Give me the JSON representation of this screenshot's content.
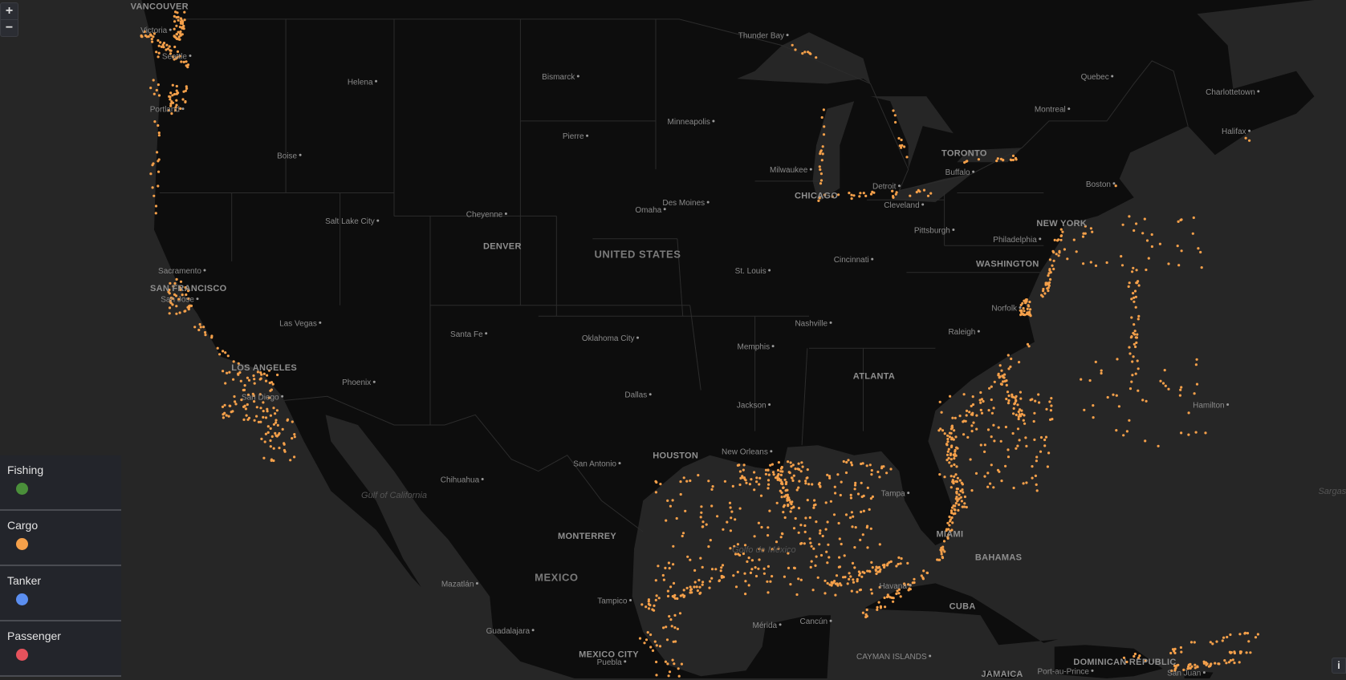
{
  "map": {
    "colors": {
      "water": "#262626",
      "land": "#0d0d0d",
      "border": "#2c2c2c",
      "vessel": "#f5a04a"
    },
    "labels": [
      {
        "name": "VANCOUVER",
        "lat": 49.5,
        "lon": -124.0,
        "cls": "major"
      },
      {
        "name": "Victoria",
        "lat": 48.6,
        "lon": -123.4,
        "cls": "city"
      },
      {
        "name": "Seattle",
        "lat": 47.6,
        "lon": -122.3,
        "cls": "city"
      },
      {
        "name": "Portland",
        "lat": 45.5,
        "lon": -122.7,
        "cls": "city"
      },
      {
        "name": "Helena",
        "lat": 46.6,
        "lon": -112.0,
        "cls": "city"
      },
      {
        "name": "Boise",
        "lat": 43.6,
        "lon": -116.2,
        "cls": "city"
      },
      {
        "name": "Salt Lake City",
        "lat": 40.8,
        "lon": -111.9,
        "cls": "city"
      },
      {
        "name": "Sacramento",
        "lat": 38.6,
        "lon": -121.5,
        "cls": "city"
      },
      {
        "name": "SAN FRANCISCO",
        "lat": 37.8,
        "lon": -122.4,
        "cls": "major"
      },
      {
        "name": "San Jose",
        "lat": 37.3,
        "lon": -121.9,
        "cls": "city"
      },
      {
        "name": "Las Vegas",
        "lat": 36.2,
        "lon": -115.1,
        "cls": "city"
      },
      {
        "name": "LOS ANGELES",
        "lat": 34.1,
        "lon": -118.2,
        "cls": "major"
      },
      {
        "name": "San Diego",
        "lat": 32.7,
        "lon": -117.2,
        "cls": "city"
      },
      {
        "name": "Phoenix",
        "lat": 33.4,
        "lon": -112.1,
        "cls": "city"
      },
      {
        "name": "Cheyenne",
        "lat": 41.1,
        "lon": -104.8,
        "cls": "city"
      },
      {
        "name": "DENVER",
        "lat": 39.7,
        "lon": -105.0,
        "cls": "major"
      },
      {
        "name": "Santa Fe",
        "lat": 35.7,
        "lon": -105.9,
        "cls": "city"
      },
      {
        "name": "UNITED STATES",
        "lat": 39.3,
        "lon": -97.5,
        "cls": "country"
      },
      {
        "name": "Bismarck",
        "lat": 46.8,
        "lon": -100.8,
        "cls": "city"
      },
      {
        "name": "Pierre",
        "lat": 44.4,
        "lon": -100.3,
        "cls": "city"
      },
      {
        "name": "Omaha",
        "lat": 41.3,
        "lon": -96.0,
        "cls": "city"
      },
      {
        "name": "Oklahoma City",
        "lat": 35.5,
        "lon": -97.5,
        "cls": "city"
      },
      {
        "name": "Dallas",
        "lat": 32.8,
        "lon": -96.8,
        "cls": "city"
      },
      {
        "name": "San Antonio",
        "lat": 29.4,
        "lon": -98.5,
        "cls": "city"
      },
      {
        "name": "HOUSTON",
        "lat": 29.8,
        "lon": -95.4,
        "cls": "major"
      },
      {
        "name": "Chihuahua",
        "lat": 28.6,
        "lon": -106.1,
        "cls": "city"
      },
      {
        "name": "Gulf of California",
        "lat": 27.8,
        "lon": -111.0,
        "cls": "water"
      },
      {
        "name": "MONTERREY",
        "lat": 25.7,
        "lon": -100.3,
        "cls": "major"
      },
      {
        "name": "MEXICO",
        "lat": 23.5,
        "lon": -102.0,
        "cls": "country"
      },
      {
        "name": "Mazatlán",
        "lat": 23.2,
        "lon": -106.4,
        "cls": "city"
      },
      {
        "name": "Tampico",
        "lat": 22.3,
        "lon": -97.9,
        "cls": "city"
      },
      {
        "name": "Guadalajara",
        "lat": 20.7,
        "lon": -103.3,
        "cls": "city"
      },
      {
        "name": "MEXICO CITY",
        "lat": 19.4,
        "lon": -99.1,
        "cls": "major"
      },
      {
        "name": "Puebla",
        "lat": 19.0,
        "lon": -98.2,
        "cls": "city"
      },
      {
        "name": "Minneapolis",
        "lat": 45.0,
        "lon": -93.3,
        "cls": "city"
      },
      {
        "name": "Des Moines",
        "lat": 41.6,
        "lon": -93.6,
        "cls": "city"
      },
      {
        "name": "St. Louis",
        "lat": 38.6,
        "lon": -90.2,
        "cls": "city"
      },
      {
        "name": "Memphis",
        "lat": 35.1,
        "lon": -90.0,
        "cls": "city"
      },
      {
        "name": "Jackson",
        "lat": 32.3,
        "lon": -90.2,
        "cls": "city"
      },
      {
        "name": "New Orleans",
        "lat": 30.0,
        "lon": -90.1,
        "cls": "city"
      },
      {
        "name": "Golfo de México",
        "lat": 25.0,
        "lon": -90.5,
        "cls": "water"
      },
      {
        "name": "Mérida",
        "lat": 21.0,
        "lon": -89.6,
        "cls": "city"
      },
      {
        "name": "Cancún",
        "lat": 21.2,
        "lon": -86.8,
        "cls": "city"
      },
      {
        "name": "Thunder Bay",
        "lat": 48.4,
        "lon": -89.2,
        "cls": "city"
      },
      {
        "name": "Milwaukee",
        "lat": 43.0,
        "lon": -87.9,
        "cls": "city"
      },
      {
        "name": "CHICAGO",
        "lat": 41.9,
        "lon": -87.6,
        "cls": "major"
      },
      {
        "name": "Detroit",
        "lat": 42.3,
        "lon": -83.0,
        "cls": "city"
      },
      {
        "name": "Cleveland",
        "lat": 41.5,
        "lon": -81.7,
        "cls": "city"
      },
      {
        "name": "TORONTO",
        "lat": 43.7,
        "lon": -79.4,
        "cls": "major"
      },
      {
        "name": "Buffalo",
        "lat": 42.9,
        "lon": -78.9,
        "cls": "city"
      },
      {
        "name": "Pittsburgh",
        "lat": 40.4,
        "lon": -80.0,
        "cls": "city"
      },
      {
        "name": "Cincinnati",
        "lat": 39.1,
        "lon": -84.5,
        "cls": "city"
      },
      {
        "name": "Nashville",
        "lat": 36.2,
        "lon": -86.8,
        "cls": "city"
      },
      {
        "name": "ATLANTA",
        "lat": 33.7,
        "lon": -84.4,
        "cls": "major"
      },
      {
        "name": "Raleigh",
        "lat": 35.8,
        "lon": -78.6,
        "cls": "city"
      },
      {
        "name": "Norfolk",
        "lat": 36.9,
        "lon": -76.3,
        "cls": "city"
      },
      {
        "name": "WASHINGTON",
        "lat": 38.9,
        "lon": -77.0,
        "cls": "major"
      },
      {
        "name": "Philadelphia",
        "lat": 40.0,
        "lon": -75.2,
        "cls": "city"
      },
      {
        "name": "NEW YORK",
        "lat": 40.7,
        "lon": -74.0,
        "cls": "major"
      },
      {
        "name": "Boston",
        "lat": 42.4,
        "lon": -71.1,
        "cls": "city"
      },
      {
        "name": "Montreal",
        "lat": 45.5,
        "lon": -73.6,
        "cls": "city"
      },
      {
        "name": "Quebec",
        "lat": 46.8,
        "lon": -71.2,
        "cls": "city"
      },
      {
        "name": "Charlottetown",
        "lat": 46.2,
        "lon": -63.1,
        "cls": "city"
      },
      {
        "name": "Halifax",
        "lat": 44.6,
        "lon": -63.6,
        "cls": "city"
      },
      {
        "name": "Tampa",
        "lat": 27.9,
        "lon": -82.5,
        "cls": "city"
      },
      {
        "name": "MIAMI",
        "lat": 25.8,
        "lon": -80.2,
        "cls": "major"
      },
      {
        "name": "BAHAMAS",
        "lat": 24.6,
        "lon": -77.5,
        "cls": "major"
      },
      {
        "name": "Havana",
        "lat": 23.1,
        "lon": -82.4,
        "cls": "city"
      },
      {
        "name": "CUBA",
        "lat": 22.0,
        "lon": -79.5,
        "cls": "major"
      },
      {
        "name": "CAYMAN ISLANDS",
        "lat": 19.3,
        "lon": -81.3,
        "cls": "city"
      },
      {
        "name": "DOMINICAN REPUBLIC",
        "lat": 19.0,
        "lon": -70.5,
        "cls": "major"
      },
      {
        "name": "Port-au-Prince",
        "lat": 18.5,
        "lon": -72.3,
        "cls": "city"
      },
      {
        "name": "San Juan",
        "lat": 18.4,
        "lon": -66.1,
        "cls": "city"
      },
      {
        "name": "JAMAICA",
        "lat": 18.1,
        "lon": -77.3,
        "cls": "major"
      },
      {
        "name": "Hamilton",
        "lat": 32.3,
        "lon": -64.8,
        "cls": "city"
      },
      {
        "name": "Sargasso Sea",
        "lat": 28.0,
        "lon": -55.0,
        "cls": "water"
      }
    ]
  },
  "controls": {
    "zoom_in": "+",
    "zoom_out": "−",
    "info": "i"
  },
  "legend": [
    {
      "label": "Fishing",
      "color": "#4a8f3a"
    },
    {
      "label": "Cargo",
      "color": "#f5a04a"
    },
    {
      "label": "Tanker",
      "color": "#5b8ef0"
    },
    {
      "label": "Passenger",
      "color": "#e5525c"
    }
  ]
}
